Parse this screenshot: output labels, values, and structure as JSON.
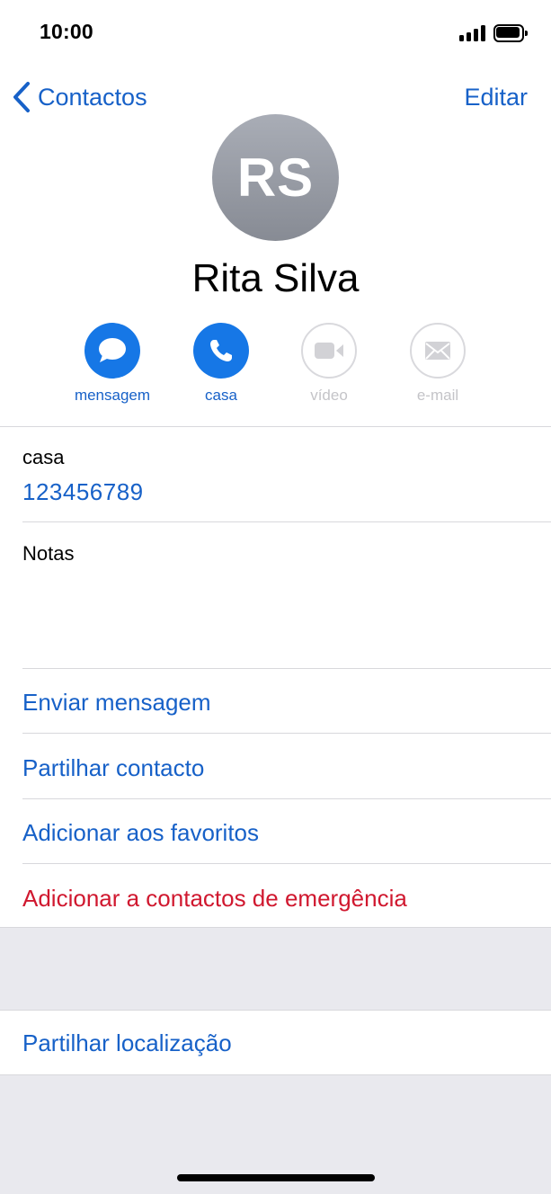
{
  "status_bar": {
    "time": "10:00"
  },
  "nav": {
    "back_label": "Contactos",
    "edit_label": "Editar"
  },
  "contact": {
    "initials": "RS",
    "name": "Rita Silva"
  },
  "actions": [
    {
      "label": "mensagem",
      "icon": "message-bubble-icon",
      "enabled": true
    },
    {
      "label": "casa",
      "icon": "phone-icon",
      "enabled": true
    },
    {
      "label": "vídeo",
      "icon": "video-camera-icon",
      "enabled": false
    },
    {
      "label": "e-mail",
      "icon": "envelope-icon",
      "enabled": false
    }
  ],
  "phone_field": {
    "label": "casa",
    "value": "123456789"
  },
  "notes": {
    "label": "Notas"
  },
  "menu": {
    "send_message": "Enviar mensagem",
    "share_contact": "Partilhar contacto",
    "add_favorites": "Adicionar aos favoritos",
    "add_emergency": "Adicionar a contactos de emergência"
  },
  "share_location": "Partilhar localização",
  "colors": {
    "accent": "#1761c8",
    "action_blue": "#1677e6",
    "danger": "#d0182f",
    "grouped_background": "#e9e9ee"
  }
}
